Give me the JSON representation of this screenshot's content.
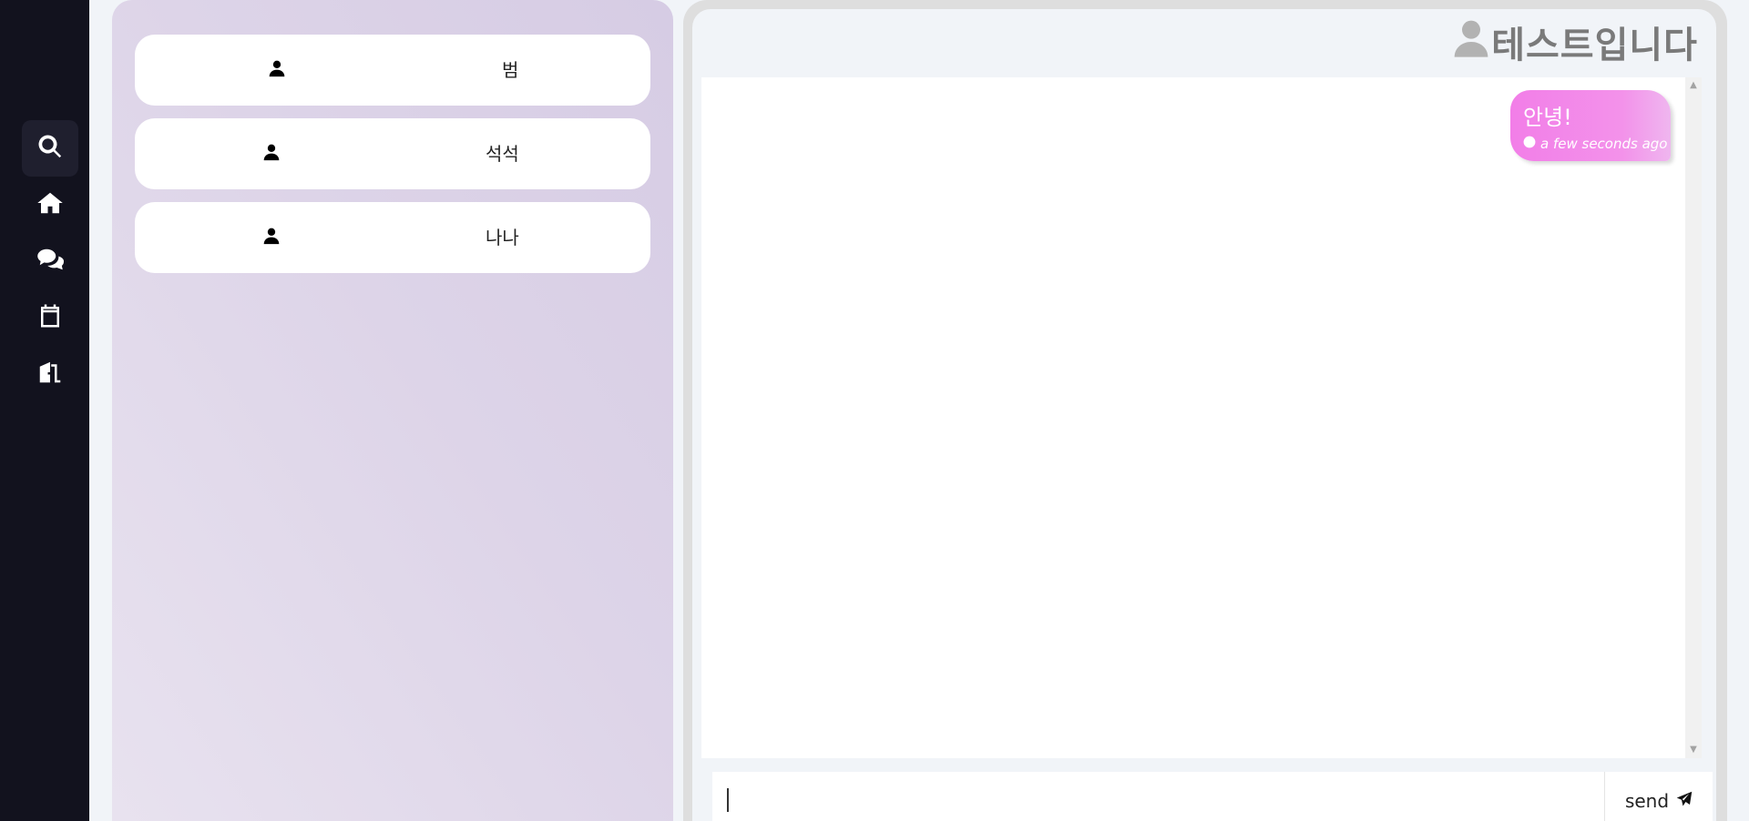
{
  "nav": {
    "items": [
      {
        "icon": "search-icon"
      },
      {
        "icon": "home-icon"
      },
      {
        "icon": "chat-icon"
      },
      {
        "icon": "calendar-icon"
      },
      {
        "icon": "logout-door-icon"
      }
    ]
  },
  "contacts": {
    "items": [
      {
        "name": "범",
        "icon": "user-icon"
      },
      {
        "name": "석석",
        "icon": "user-icon"
      },
      {
        "name": "나나",
        "icon": "user-icon"
      }
    ]
  },
  "chat": {
    "title": "테스트입니다",
    "title_icon": "user-icon",
    "messages": [
      {
        "text": "안녕!",
        "time": "a few seconds ago",
        "time_icon": "clock-icon"
      }
    ],
    "input": {
      "value": "",
      "placeholder": ""
    },
    "send_label": "send",
    "send_icon": "paper-plane-icon"
  },
  "colors": {
    "nav_bg": "#12121e",
    "bubble_gradient_start": "#f27ee8",
    "bubble_gradient_end": "#efb6ef",
    "contacts_panel": "#ddd4e8",
    "title_color": "#7a7a7a"
  }
}
